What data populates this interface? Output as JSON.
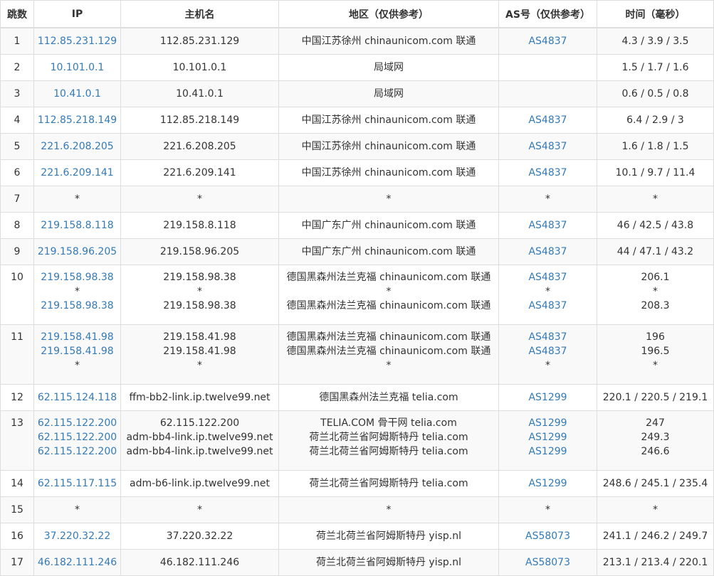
{
  "headers": {
    "hop": "跳数",
    "ip": "IP",
    "host": "主机名",
    "region": "地区（仅供参考）",
    "asn": "AS号（仅供参考）",
    "time": "时间（毫秒）"
  },
  "rows": [
    {
      "hop": "1",
      "ip": [
        "112.85.231.129"
      ],
      "host": [
        "112.85.231.129"
      ],
      "region": [
        "中国江苏徐州 chinaunicom.com 联通"
      ],
      "asn": [
        "AS4837"
      ],
      "time": [
        "4.3 / 3.9 / 3.5"
      ]
    },
    {
      "hop": "2",
      "ip": [
        "10.101.0.1"
      ],
      "host": [
        "10.101.0.1"
      ],
      "region": [
        "局域网"
      ],
      "asn": [
        ""
      ],
      "time": [
        "1.5 / 1.7 / 1.6"
      ]
    },
    {
      "hop": "3",
      "ip": [
        "10.41.0.1"
      ],
      "host": [
        "10.41.0.1"
      ],
      "region": [
        "局域网"
      ],
      "asn": [
        ""
      ],
      "time": [
        "0.6 / 0.5 / 0.8"
      ]
    },
    {
      "hop": "4",
      "ip": [
        "112.85.218.149"
      ],
      "host": [
        "112.85.218.149"
      ],
      "region": [
        "中国江苏徐州 chinaunicom.com 联通"
      ],
      "asn": [
        "AS4837"
      ],
      "time": [
        "6.4 / 2.9 / 3"
      ]
    },
    {
      "hop": "5",
      "ip": [
        "221.6.208.205"
      ],
      "host": [
        "221.6.208.205"
      ],
      "region": [
        "中国江苏徐州 chinaunicom.com 联通"
      ],
      "asn": [
        "AS4837"
      ],
      "time": [
        "1.6 / 1.8 / 1.5"
      ]
    },
    {
      "hop": "6",
      "ip": [
        "221.6.209.141"
      ],
      "host": [
        "221.6.209.141"
      ],
      "region": [
        "中国江苏徐州 chinaunicom.com 联通"
      ],
      "asn": [
        "AS4837"
      ],
      "time": [
        "10.1 / 9.7 / 11.4"
      ]
    },
    {
      "hop": "7",
      "ip": [
        "*"
      ],
      "host": [
        "*"
      ],
      "region": [
        "*"
      ],
      "asn": [
        "*"
      ],
      "time": [
        "*"
      ]
    },
    {
      "hop": "8",
      "ip": [
        "219.158.8.118"
      ],
      "host": [
        "219.158.8.118"
      ],
      "region": [
        "中国广东广州 chinaunicom.com 联通"
      ],
      "asn": [
        "AS4837"
      ],
      "time": [
        "46 / 42.5 / 43.8"
      ]
    },
    {
      "hop": "9",
      "ip": [
        "219.158.96.205"
      ],
      "host": [
        "219.158.96.205"
      ],
      "region": [
        "中国广东广州 chinaunicom.com 联通"
      ],
      "asn": [
        "AS4837"
      ],
      "time": [
        "44 / 47.1 / 43.2"
      ]
    },
    {
      "hop": "10",
      "ip": [
        "219.158.98.38",
        "*",
        "219.158.98.38"
      ],
      "host": [
        "219.158.98.38",
        "*",
        "219.158.98.38"
      ],
      "region": [
        "德国黑森州法兰克福 chinaunicom.com 联通",
        "*",
        "德国黑森州法兰克福 chinaunicom.com 联通"
      ],
      "asn": [
        "AS4837",
        "*",
        "AS4837"
      ],
      "time": [
        "206.1",
        "*",
        "208.3"
      ]
    },
    {
      "hop": "11",
      "ip": [
        "219.158.41.98",
        "219.158.41.98",
        "*"
      ],
      "host": [
        "219.158.41.98",
        "219.158.41.98",
        "*"
      ],
      "region": [
        "德国黑森州法兰克福 chinaunicom.com 联通",
        "德国黑森州法兰克福 chinaunicom.com 联通",
        "*"
      ],
      "asn": [
        "AS4837",
        "AS4837",
        "*"
      ],
      "time": [
        "196",
        "196.5",
        "*"
      ]
    },
    {
      "hop": "12",
      "ip": [
        "62.115.124.118"
      ],
      "host": [
        "ffm-bb2-link.ip.twelve99.net"
      ],
      "region": [
        "德国黑森州法兰克福 telia.com"
      ],
      "asn": [
        "AS1299"
      ],
      "time": [
        "220.1 / 220.5 / 219.1"
      ]
    },
    {
      "hop": "13",
      "ip": [
        "62.115.122.200",
        "62.115.122.200",
        "62.115.122.200"
      ],
      "host": [
        "62.115.122.200",
        "adm-bb4-link.ip.twelve99.net",
        "adm-bb4-link.ip.twelve99.net"
      ],
      "region": [
        "TELIA.COM 骨干网 telia.com",
        "荷兰北荷兰省阿姆斯特丹 telia.com",
        "荷兰北荷兰省阿姆斯特丹 telia.com"
      ],
      "asn": [
        "AS1299",
        "AS1299",
        "AS1299"
      ],
      "time": [
        "247",
        "249.3",
        "246.6"
      ]
    },
    {
      "hop": "14",
      "ip": [
        "62.115.117.115"
      ],
      "host": [
        "adm-b6-link.ip.twelve99.net"
      ],
      "region": [
        "荷兰北荷兰省阿姆斯特丹 telia.com"
      ],
      "asn": [
        "AS1299"
      ],
      "time": [
        "248.6 / 245.1 / 235.4"
      ]
    },
    {
      "hop": "15",
      "ip": [
        "*"
      ],
      "host": [
        "*"
      ],
      "region": [
        "*"
      ],
      "asn": [
        "*"
      ],
      "time": [
        "*"
      ]
    },
    {
      "hop": "16",
      "ip": [
        "37.220.32.22"
      ],
      "host": [
        "37.220.32.22"
      ],
      "region": [
        "荷兰北荷兰省阿姆斯特丹 yisp.nl"
      ],
      "asn": [
        "AS58073"
      ],
      "time": [
        "241.1 / 246.2 / 249.7"
      ]
    },
    {
      "hop": "17",
      "ip": [
        "46.182.111.246"
      ],
      "host": [
        "46.182.111.246"
      ],
      "region": [
        "荷兰北荷兰省阿姆斯特丹 yisp.nl"
      ],
      "asn": [
        "AS58073"
      ],
      "time": [
        "213.1 / 213.4 / 220.1"
      ]
    }
  ]
}
